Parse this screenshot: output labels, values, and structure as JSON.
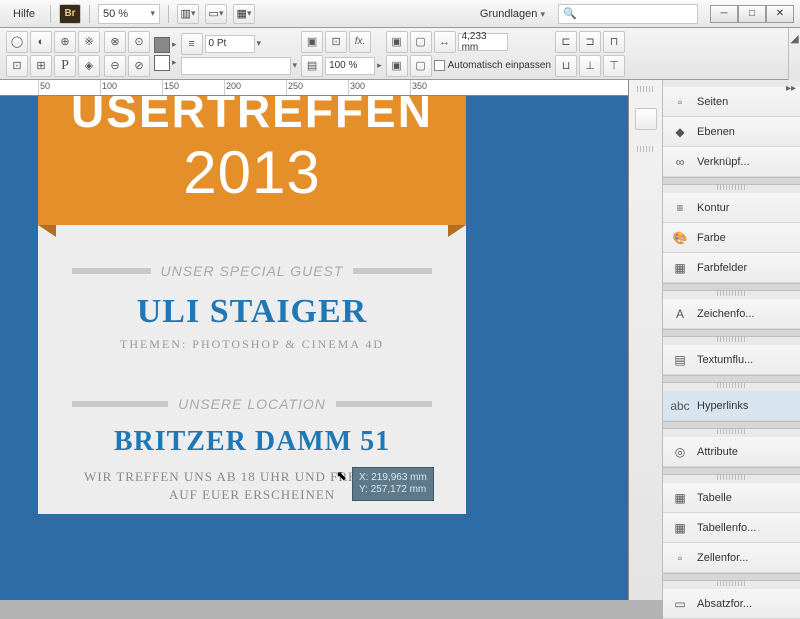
{
  "menubar": {
    "help": "Hilfe",
    "bridge": "Br",
    "zoom": "50 %",
    "workspace_label": "Grundlagen",
    "search_placeholder": ""
  },
  "controlbar": {
    "stroke_value": "0 Pt",
    "opacity_value": "100 %",
    "width_value": "4,233 mm",
    "autofit_label": "Automatisch einpassen"
  },
  "ruler": {
    "ticks": [
      "50",
      "100",
      "150",
      "200",
      "250",
      "300",
      "350"
    ]
  },
  "document": {
    "banner_line1": "USERTREFFEN",
    "banner_line2": "2013",
    "guest_divider": "UNSER SPECIAL GUEST",
    "guest_name": "ULI STAIGER",
    "guest_sub": "THEMEN: PHOTOSHOP & CINEMA 4D",
    "location_divider": "UNSERE LOCATION",
    "location_name": "BRITZER DAMM 51",
    "location_body": "WIR TREFFEN UNS AB 18 UHR UND\nFREUEN UNS AUF EUER ERSCHEINEN"
  },
  "cursor_readout": {
    "x": "X: 219,963 mm",
    "y": "Y: 257,172 mm"
  },
  "panels": [
    {
      "label": "Seiten",
      "icon": "▫"
    },
    {
      "label": "Ebenen",
      "icon": "◆"
    },
    {
      "label": "Verknüpf...",
      "icon": "∞"
    },
    {
      "gap": true
    },
    {
      "label": "Kontur",
      "icon": "≡"
    },
    {
      "label": "Farbe",
      "icon": "🎨"
    },
    {
      "label": "Farbfelder",
      "icon": "▦"
    },
    {
      "gap": true
    },
    {
      "label": "Zeichenfo...",
      "icon": "A"
    },
    {
      "gap": true
    },
    {
      "label": "Textumflu...",
      "icon": "▤"
    },
    {
      "gap": true
    },
    {
      "label": "Hyperlinks",
      "icon": "abc",
      "sel": true
    },
    {
      "gap": true
    },
    {
      "label": "Attribute",
      "icon": "◎"
    },
    {
      "gap": true
    },
    {
      "label": "Tabelle",
      "icon": "▦"
    },
    {
      "label": "Tabellenfo...",
      "icon": "▦"
    },
    {
      "label": "Zellenfor...",
      "icon": "▫"
    },
    {
      "gap": true
    },
    {
      "label": "Absatzfor...",
      "icon": "▭"
    }
  ]
}
